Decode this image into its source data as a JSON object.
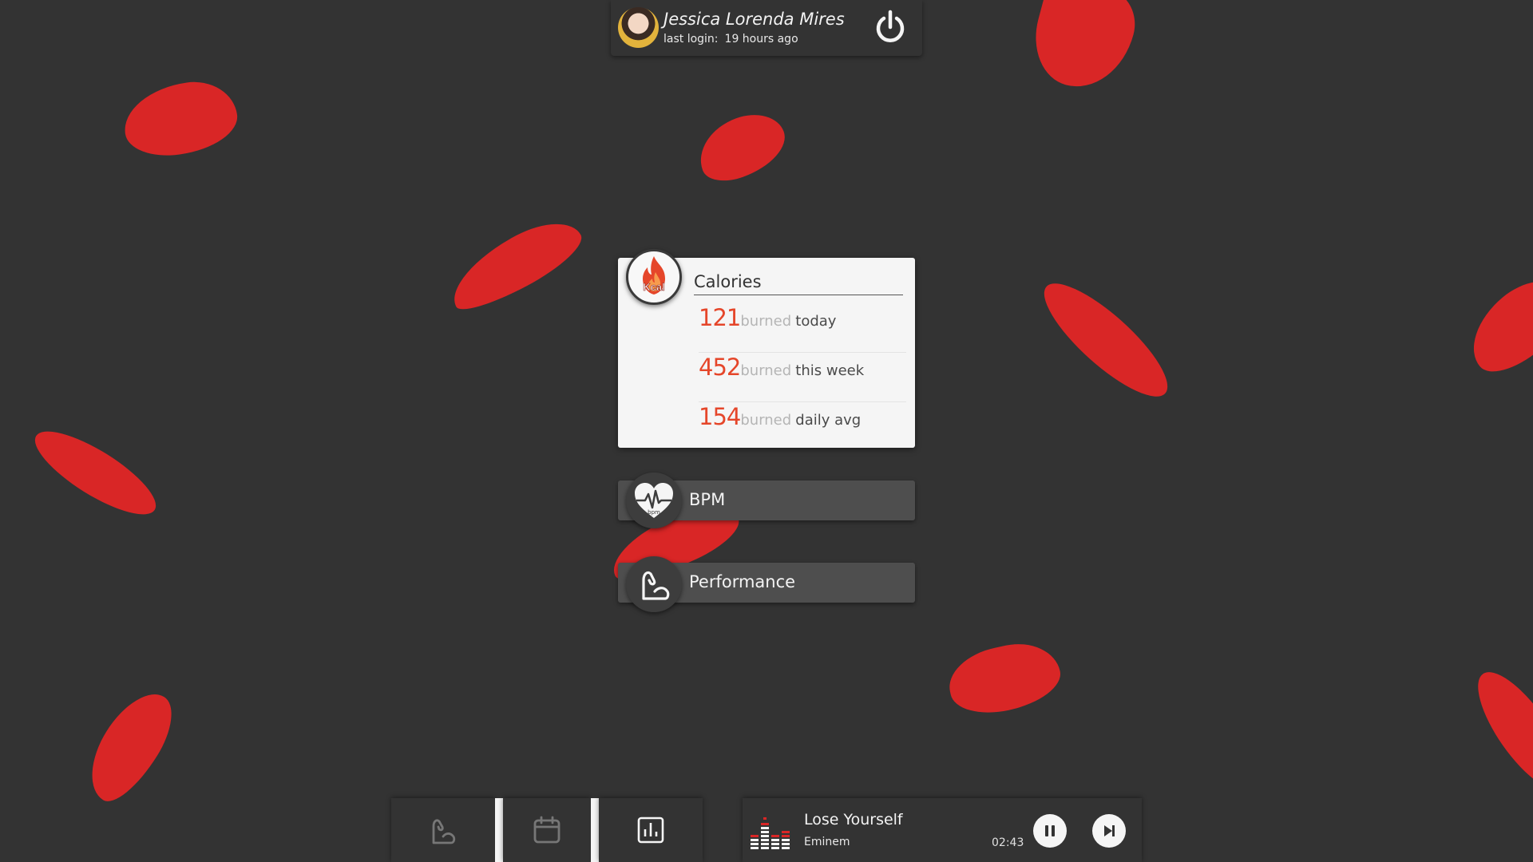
{
  "colors": {
    "background": "#333333",
    "accent_red": "#d92626",
    "calorie_value": "#e5462a",
    "card_bg": "#f5f5f5",
    "panel_bg": "#4e4e4e"
  },
  "user": {
    "name": "Jessica Lorenda Mires",
    "last_login_label": "last login:",
    "last_login_value": "19 hours ago",
    "avatar_icon": "user-avatar",
    "power_icon": "power-icon"
  },
  "calories": {
    "title": "Calories",
    "badge_text": "Kcal",
    "icon": "flame-icon",
    "rows": [
      {
        "value": "121",
        "burned": "burned",
        "period": "today"
      },
      {
        "value": "452",
        "burned": "burned",
        "period": "this week"
      },
      {
        "value": "154",
        "burned": "burned",
        "period": "daily avg"
      }
    ]
  },
  "bpm": {
    "label": "BPM",
    "badge_text": "bpm",
    "icon": "heart-pulse-icon"
  },
  "performance": {
    "label": "Performance",
    "icon": "flexed-arm-icon"
  },
  "nav": {
    "items": [
      {
        "name": "performance",
        "icon": "flexed-arm-icon"
      },
      {
        "name": "calendar",
        "icon": "calendar-icon"
      },
      {
        "name": "stats",
        "icon": "bar-chart-icon"
      }
    ]
  },
  "player": {
    "title": "Lose Yourself",
    "artist": "Eminem",
    "time": "02:43",
    "equalizer_icon": "equalizer-icon",
    "pause_icon": "pause-icon",
    "next_icon": "skip-next-icon"
  }
}
